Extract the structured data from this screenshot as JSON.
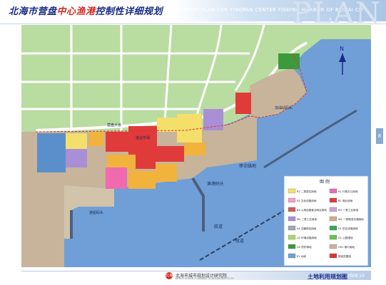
{
  "header": {
    "title_prefix": "北海市营盘",
    "title_accent": "中心渔港",
    "title_suffix": "控制性详细规划",
    "subtitle_en": "REGULATORY PLAN FOR YINGPAN CENTER FISHING HARBOR OF BEIHAI CITY",
    "watermark": "PLAN"
  },
  "map": {
    "labels": {
      "breakwater_north": "堤坝",
      "waterway_mid": "港池",
      "waterway_south": "航道",
      "channel_left": "航道",
      "road_main": "营盘大道",
      "pier_label": "渔港码头",
      "berth_label": "停泊锚地",
      "fish_market": "渔业市场",
      "depot_label": "加油站码头",
      "ferry_label": "渡船码头"
    },
    "colors": {
      "sea": "#6f9fd6",
      "land_green": "#b9dca0",
      "road": "#ffffff",
      "industrial": "#a98fd6",
      "commercial": "#e03a3a",
      "public": "#f2b33c",
      "residential": "#f5df6b",
      "warehouse": "#d8aa8a",
      "port": "#c7b49a",
      "admin": "#a9c6e6"
    }
  },
  "legend": {
    "title": "图  例",
    "items": [
      {
        "code": "R2",
        "label": "二类居住用地",
        "color": "#f5df6b"
      },
      {
        "code": "A1",
        "label": "行政办公用地",
        "color": "#f06ab0"
      },
      {
        "code": "A2",
        "label": "文化设施用地",
        "color": "#f3a0c8"
      },
      {
        "code": "B1",
        "label": "商业用地",
        "color": "#e03a3a"
      },
      {
        "code": "B4",
        "label": "公用设施营业网点用地",
        "color": "#cf5b5b"
      },
      {
        "code": "M1",
        "label": "一类工业用地",
        "color": "#c8a4da"
      },
      {
        "code": "M2",
        "label": "二类工业用地",
        "color": "#a98fd6"
      },
      {
        "code": "W1",
        "label": "一类物流仓储用地",
        "color": "#d8aa8a"
      },
      {
        "code": "S4",
        "label": "交通场站用地",
        "color": "#9fa9b3"
      },
      {
        "code": "U1",
        "label": "供应设施用地",
        "color": "#35a85c"
      },
      {
        "code": "U2",
        "label": "环境设施用地",
        "color": "#a7d86f"
      },
      {
        "code": "G1",
        "label": "公园绿地",
        "color": "#67c44a"
      },
      {
        "code": "G2",
        "label": "防护绿地",
        "color": "#3c9a3c"
      },
      {
        "code": "H41",
        "label": "港口用地",
        "color": "#c7b49a"
      },
      {
        "code": "E1",
        "label": "水域",
        "color": "#6f9fd6"
      },
      {
        "code": "",
        "label": "规划范围线",
        "color": "#e0322c"
      }
    ]
  },
  "footer": {
    "logo_text": "北海",
    "org_name": "北海市城市规划设计研究院",
    "org_name_en": "BEIHAI URBAN PLANNING & DESIGN INSTITUTE",
    "sheet_title": "土地利用规划图",
    "date": "2008.10",
    "page_no": "8"
  },
  "north_arrow": {
    "symbol": "N"
  }
}
